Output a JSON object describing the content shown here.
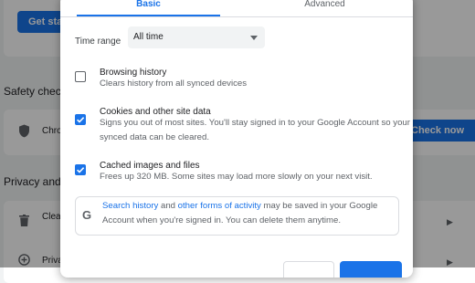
{
  "background": {
    "get_started_button": "Get started",
    "safety_check_heading": "Safety check",
    "safety_check_row_text": "Chrome",
    "check_now_button": "Check now",
    "privacy_heading": "Privacy and security",
    "clear_row_text": "Clear",
    "privacy_row_text": "Privacy"
  },
  "dialog": {
    "tabs": {
      "basic": "Basic",
      "advanced": "Advanced"
    },
    "time_range": {
      "label": "Time range",
      "value": "All time"
    },
    "options": [
      {
        "title": "Browsing history",
        "description": "Clears history from all synced devices",
        "checked": false
      },
      {
        "title": "Cookies and other site data",
        "description": "Signs you out of most sites. You'll stay signed in to your Google Account so your synced data can be cleared.",
        "checked": true
      },
      {
        "title": "Cached images and files",
        "description": "Frees up 320 MB. Some sites may load more slowly on your next visit.",
        "checked": true
      }
    ],
    "info": {
      "link1": "Search history",
      "and": " and ",
      "link2": "other forms of activity",
      "rest": " may be saved in your Google Account when you're signed in. You can delete them anytime.",
      "icon": "google-g-icon"
    }
  },
  "colors": {
    "accent": "#1a73e8",
    "text": "#202124",
    "secondary_text": "#5f6368",
    "divider": "#dadce0"
  }
}
